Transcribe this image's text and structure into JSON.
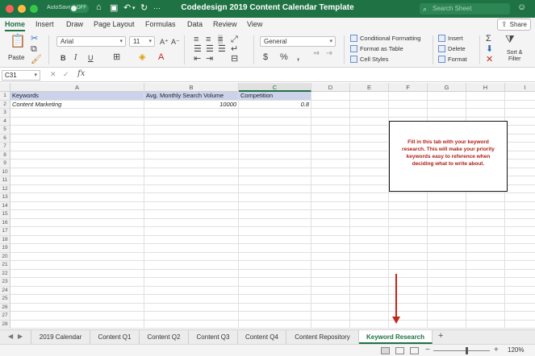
{
  "titlebar": {
    "autosave_label": "AutoSave",
    "autosave_state": "OFF",
    "title": "Codedesign 2019 Content Calendar Template",
    "search_placeholder": "Search Sheet",
    "traffic_colors": [
      "#fc605b",
      "#fdbc40",
      "#34c84a"
    ]
  },
  "ribbon_tabs": [
    "Home",
    "Insert",
    "Draw",
    "Page Layout",
    "Formulas",
    "Data",
    "Review",
    "View"
  ],
  "active_tab": "Home",
  "share_label": "Share",
  "ribbon": {
    "paste_label": "Paste",
    "font_name": "Arial",
    "font_size": "11",
    "number_format": "General",
    "bold": "B",
    "italic": "I",
    "underline": "U",
    "currency": "$",
    "percent": "%",
    "comma": "͈",
    "styles": [
      "Conditional Formatting",
      "Format as Table",
      "Cell Styles"
    ],
    "cells": [
      "Insert",
      "Delete",
      "Format"
    ],
    "sort_filter_label": "Sort &\nFilter"
  },
  "formula_bar": {
    "cell_ref": "C31",
    "fx": "fx",
    "value": ""
  },
  "grid": {
    "columns": [
      "A",
      "B",
      "C",
      "D",
      "E",
      "F",
      "G",
      "H",
      "I"
    ],
    "selected_column": "C",
    "rows": [
      "1",
      "2",
      "3",
      "4",
      "5",
      "6",
      "7",
      "8",
      "9",
      "10",
      "11",
      "12",
      "13",
      "14",
      "15",
      "16",
      "17",
      "18",
      "19",
      "20",
      "21",
      "22",
      "23",
      "24",
      "25",
      "26",
      "27",
      "28"
    ],
    "cells": {
      "A1": "Keywords",
      "B1": "Avg. Monthly Search Volume",
      "C1": "Competition",
      "A2": "Content Marketing",
      "B2": "10000",
      "C2": "0.8"
    }
  },
  "note": "Fill in this tab with your keyword research. This will make your priority keywords easy to reference when deciding what to write about.",
  "sheet_tabs": [
    "2019 Calendar",
    "Content Q1",
    "Content Q2",
    "Content Q3",
    "Content Q4",
    "Content Repository",
    "Keyword Research"
  ],
  "active_sheet": "Keyword Research",
  "status": {
    "zoom": "120%"
  },
  "colors": {
    "accent": "#1f7244",
    "header_fill": "#ccd2ea",
    "note_text": "#b01c14",
    "arrow": "#c0281d"
  }
}
